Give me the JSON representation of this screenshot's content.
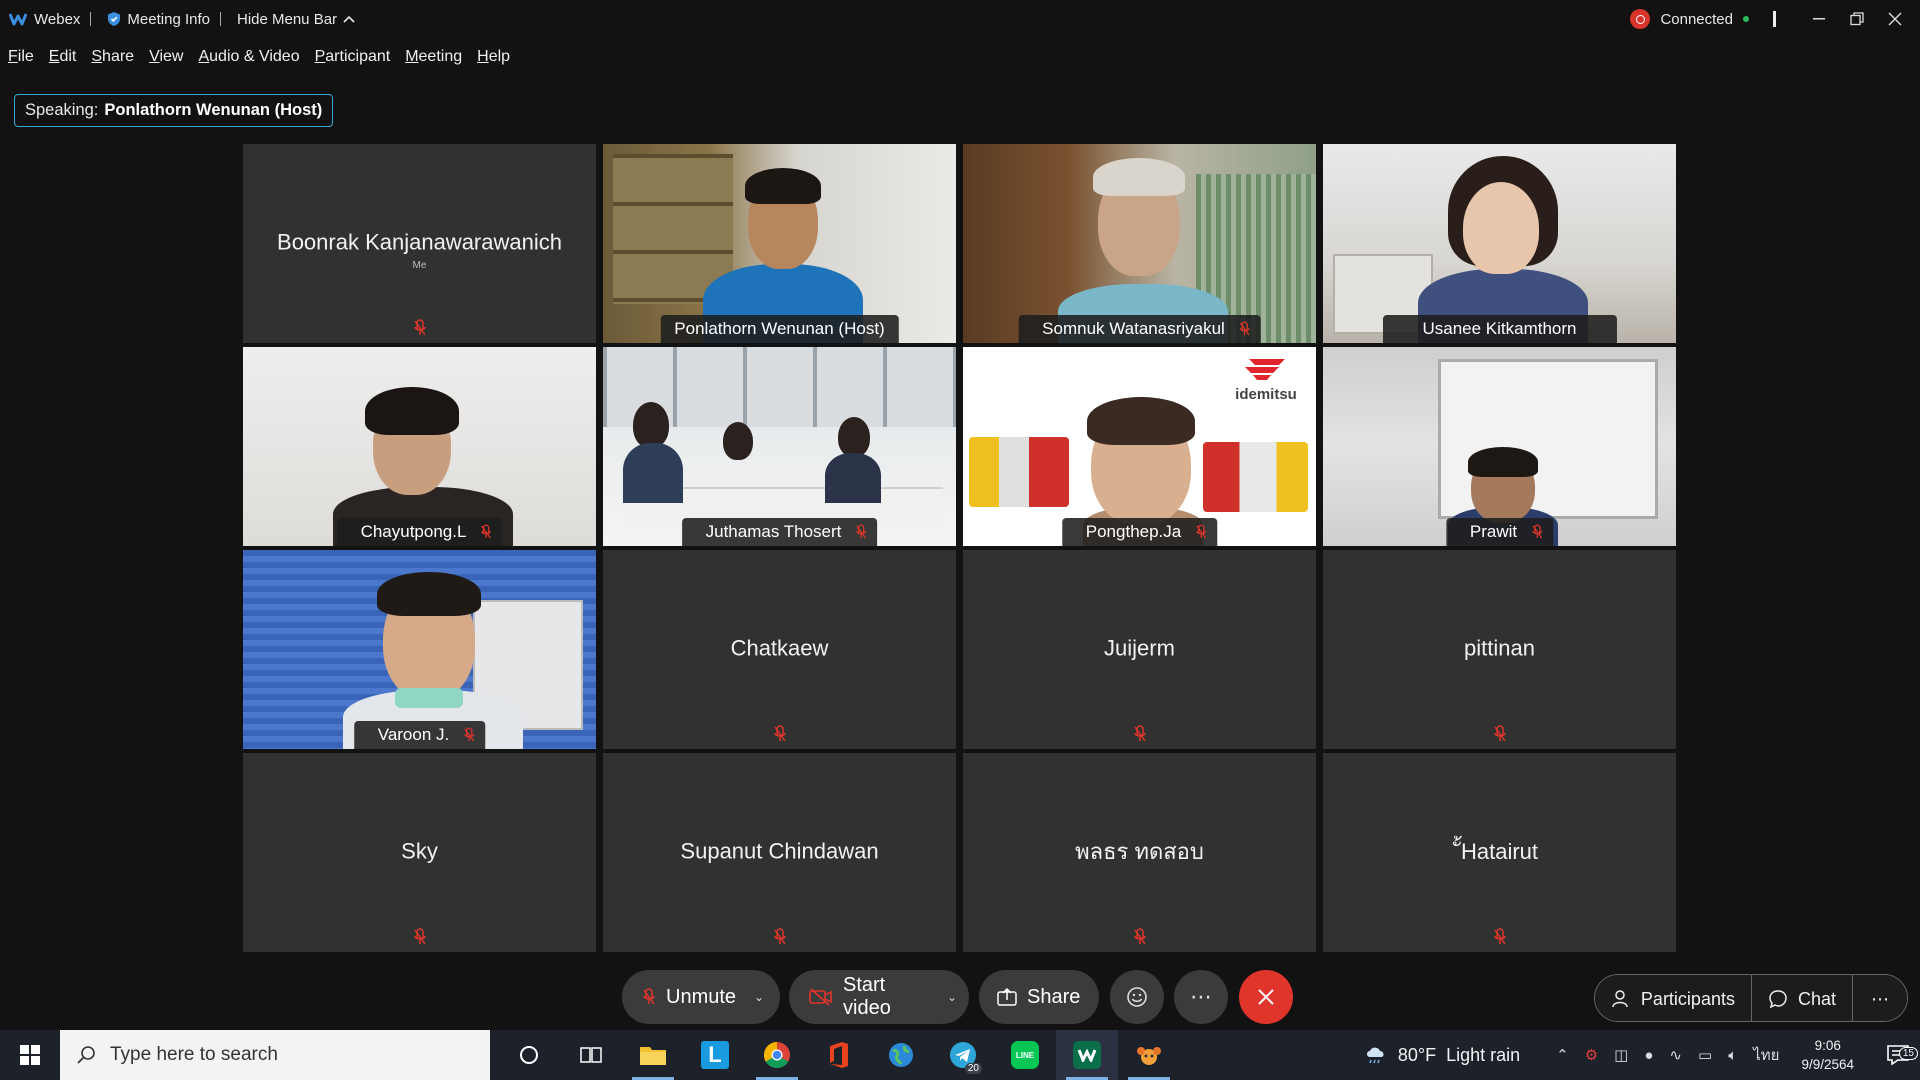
{
  "titlebar": {
    "app_name": "Webex",
    "meeting_info": "Meeting Info",
    "hide_menu_bar": "Hide Menu Bar",
    "status": "Connected"
  },
  "menu": {
    "items": [
      {
        "first": "F",
        "rest": "ile"
      },
      {
        "first": "E",
        "rest": "dit"
      },
      {
        "first": "S",
        "rest": "hare"
      },
      {
        "first": "V",
        "rest": "iew"
      },
      {
        "first": "A",
        "rest": "udio & Video"
      },
      {
        "first": "P",
        "rest": "articipant"
      },
      {
        "first": "M",
        "rest": "eeting"
      },
      {
        "first": "H",
        "rest": "elp"
      }
    ]
  },
  "speaking": {
    "label": "Speaking:",
    "name": "Ponlathorn Wenunan (Host)"
  },
  "tiles": [
    {
      "name": "Boonrak Kanjanawarawanich",
      "sub": "Me"
    },
    {
      "name": "Ponlathorn Wenunan  (Host)"
    },
    {
      "name": "Somnuk Watanasriyakul"
    },
    {
      "name": "Usanee Kitkamthorn"
    },
    {
      "name": "Chayutpong.L"
    },
    {
      "name": "Juthamas Thosert"
    },
    {
      "name": "Pongthep.Ja",
      "ad_brand": "idemitsu"
    },
    {
      "name": "Prawit"
    },
    {
      "name": "Varoon J."
    },
    {
      "name": "Chatkaew"
    },
    {
      "name": "Juijerm"
    },
    {
      "name": "pittinan"
    },
    {
      "name": "Sky"
    },
    {
      "name": "Supanut Chindawan"
    },
    {
      "name": "พลธร ทดสอบ"
    },
    {
      "name": "ั้Hatairut"
    }
  ],
  "controls": {
    "unmute": "Unmute",
    "start_video": "Start video",
    "share": "Share",
    "participants": "Participants",
    "chat": "Chat"
  },
  "taskbar": {
    "search_placeholder": "Type here to search",
    "weather_temp": "80°F",
    "weather_text": "Light rain",
    "language": "ไทย",
    "time": "9:06",
    "date": "9/9/2564",
    "notification_count": "15",
    "telegram_badge": "20"
  },
  "colors": {
    "accent": "#29b5e8",
    "end_call": "#e0352b",
    "muted_icon": "#e0352b",
    "tile_bg": "#313131"
  }
}
